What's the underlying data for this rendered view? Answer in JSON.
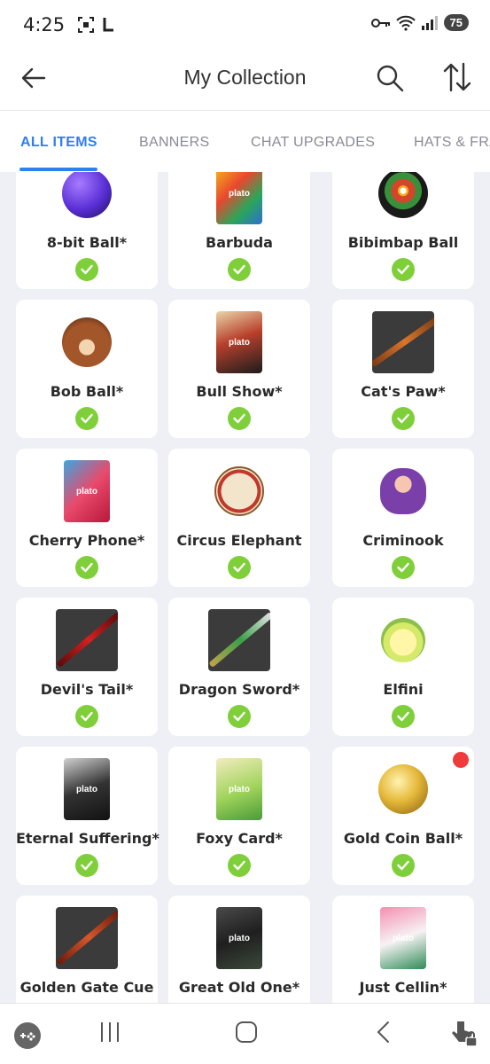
{
  "status": {
    "time": "4:25",
    "battery": "75"
  },
  "app_bar": {
    "title": "My Collection"
  },
  "tabs": [
    {
      "label": "ALL ITEMS"
    },
    {
      "label": "BANNERS"
    },
    {
      "label": "CHAT UPGRADES"
    },
    {
      "label": "HATS & FRA"
    }
  ],
  "items": [
    {
      "name": "8-bit Ball*",
      "art": "ball-icon",
      "owned": true
    },
    {
      "name": "Barbuda",
      "art": "card-icon",
      "owned": true
    },
    {
      "name": "Bibimbap Ball",
      "art": "ball-icon",
      "owned": true
    },
    {
      "name": "Bob Ball*",
      "art": "ball-icon",
      "owned": true
    },
    {
      "name": "Bull Show*",
      "art": "card-icon",
      "owned": true
    },
    {
      "name": "Cat's Paw*",
      "art": "cue-icon",
      "owned": true
    },
    {
      "name": "Cherry Phone*",
      "art": "card-icon",
      "owned": true
    },
    {
      "name": "Circus Elephant",
      "art": "elephant-icon",
      "owned": true
    },
    {
      "name": "Criminook",
      "art": "character-icon",
      "owned": true
    },
    {
      "name": "Devil's Tail*",
      "art": "cue-icon",
      "owned": true
    },
    {
      "name": "Dragon Sword*",
      "art": "cue-icon",
      "owned": true
    },
    {
      "name": "Elfini",
      "art": "character-icon",
      "owned": true
    },
    {
      "name": "Eternal Suffering*",
      "art": "card-icon",
      "owned": true
    },
    {
      "name": "Foxy Card*",
      "art": "card-icon",
      "owned": true
    },
    {
      "name": "Gold Coin Ball*",
      "art": "ball-icon",
      "owned": true,
      "new": true
    },
    {
      "name": "Golden Gate Cue",
      "art": "cue-icon",
      "owned": true
    },
    {
      "name": "Great Old One*",
      "art": "card-icon",
      "owned": true
    },
    {
      "name": "Just Cellin*",
      "art": "card-icon",
      "owned": true
    }
  ],
  "card_brand": "plato",
  "colors": {
    "accent": "#2f7ff0",
    "check": "#7fcf3a",
    "badge": "#ef3b3b"
  }
}
